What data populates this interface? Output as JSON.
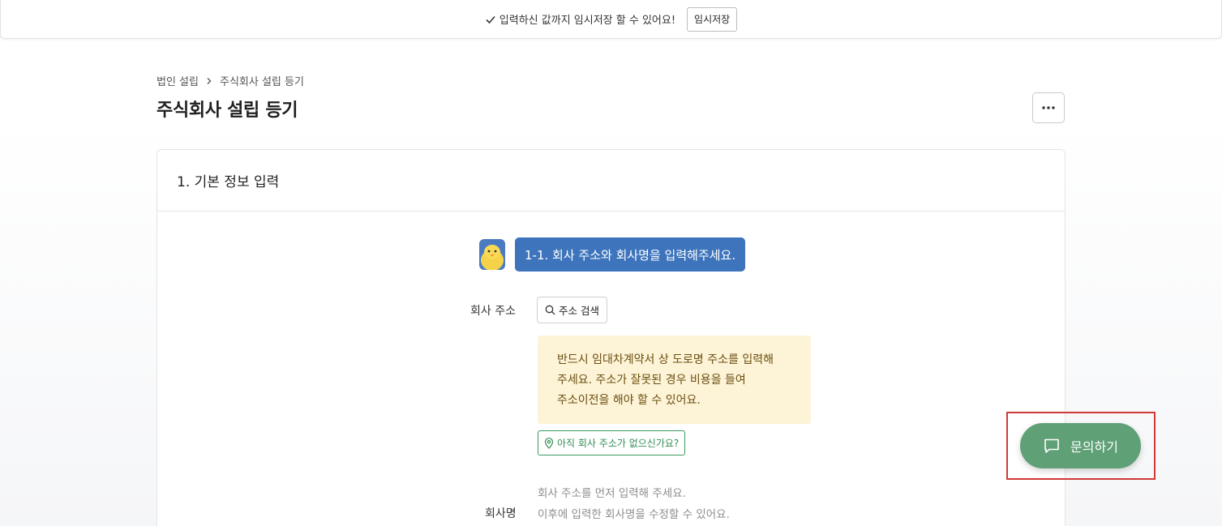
{
  "savebar": {
    "message": "입력하신 값까지 임시저장 할 수 있어요!",
    "save_label": "임시저장"
  },
  "breadcrumb": {
    "parent": "법인 설립",
    "current": "주식회사 설립 등기"
  },
  "page_title": "주식회사 설립 등기",
  "section": {
    "title": "1. 기본 정보 입력",
    "bot_message": "1-1. 회사 주소와 회사명을 입력해주세요.",
    "address": {
      "label": "회사 주소",
      "search_label": "주소 검색",
      "notice_lines": [
        "반드시 임대차계약서 상 도로명 주소를 입력해",
        "주세요. 주소가 잘못된 경우 비용을 들여",
        "주소이전을 해야 할 수 있어요."
      ],
      "no_address_label": "아직 회사 주소가 없으신가요?"
    },
    "company_name": {
      "label": "회사명",
      "hint_lines": [
        "회사 주소를 먼저 입력해 주세요.",
        "이후에 입력한 회사명을 수정할 수 있어요."
      ]
    }
  },
  "chat": {
    "label": "문의하기"
  },
  "colors": {
    "bubble": "#3d74bc",
    "notice_bg": "#fdf3d6",
    "green": "#5fa077",
    "highlight": "#d03a36"
  }
}
